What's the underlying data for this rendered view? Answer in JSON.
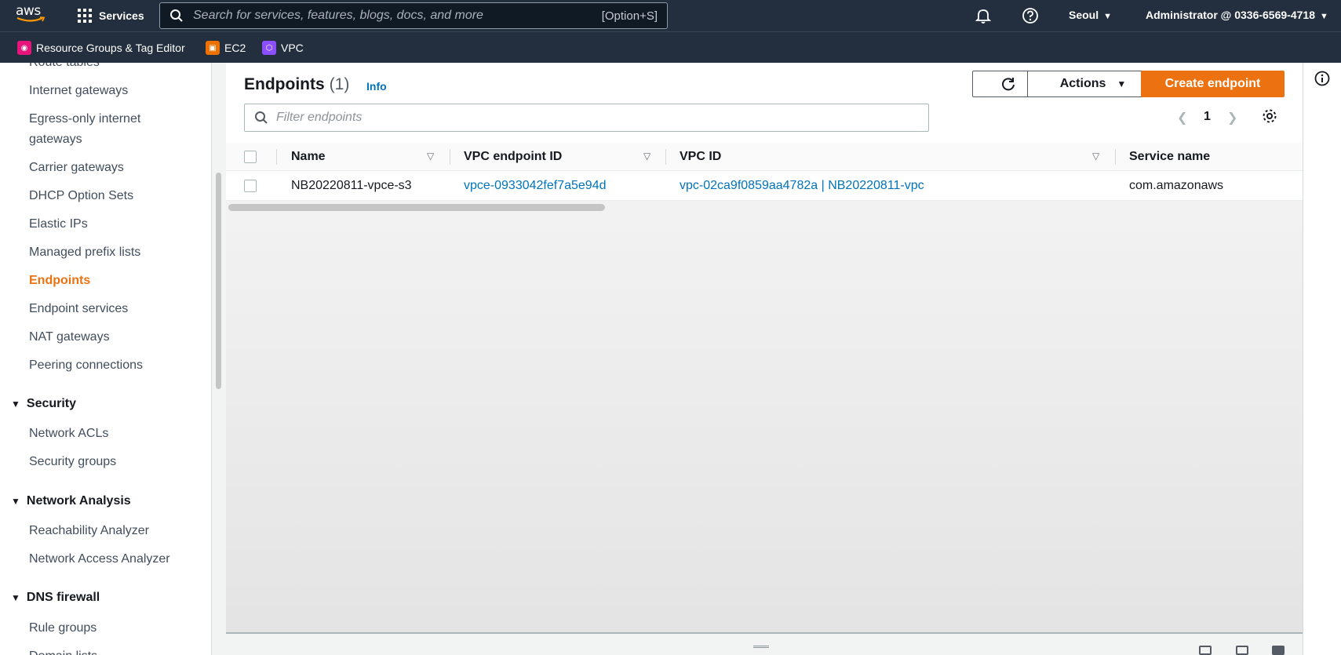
{
  "topnav": {
    "logo_text": "aws",
    "services_label": "Services",
    "search_placeholder": "Search for services, features, blogs, docs, and more",
    "search_shortcut": "[Option+S]",
    "region": "Seoul",
    "account": "Administrator @ 0336-6569-4718"
  },
  "favorites": [
    {
      "label": "Resource Groups & Tag Editor",
      "icon": "resource-groups-icon",
      "color": "#e7157b"
    },
    {
      "label": "EC2",
      "icon": "ec2-icon",
      "color": "#ed7100"
    },
    {
      "label": "VPC",
      "icon": "vpc-icon",
      "color": "#8c4fff"
    }
  ],
  "sidebar": {
    "items": [
      {
        "label": "Route tables"
      },
      {
        "label": "Internet gateways"
      },
      {
        "label": "Egress-only internet gateways"
      },
      {
        "label": "Carrier gateways"
      },
      {
        "label": "DHCP Option Sets"
      },
      {
        "label": "Elastic IPs"
      },
      {
        "label": "Managed prefix lists"
      },
      {
        "label": "Endpoints",
        "active": true
      },
      {
        "label": "Endpoint services"
      },
      {
        "label": "NAT gateways"
      },
      {
        "label": "Peering connections"
      }
    ],
    "sections": [
      {
        "title": "Security",
        "items": [
          "Network ACLs",
          "Security groups"
        ]
      },
      {
        "title": "Network Analysis",
        "items": [
          "Reachability Analyzer",
          "Network Access Analyzer"
        ]
      },
      {
        "title": "DNS firewall",
        "items": [
          "Rule groups",
          "Domain lists"
        ]
      }
    ]
  },
  "main": {
    "title": "Endpoints",
    "count": "(1)",
    "info": "Info",
    "actions_label": "Actions",
    "create_label": "Create endpoint",
    "filter_placeholder": "Filter endpoints",
    "page": "1",
    "columns": [
      "Name",
      "VPC endpoint ID",
      "VPC ID",
      "Service name"
    ],
    "rows": [
      {
        "name": "NB20220811-vpce-s3",
        "endpoint_id": "vpce-0933042fef7a5e94d",
        "vpc_id": "vpc-02ca9f0859aa4782a | NB20220811-vpc",
        "service_name": "com.amazonaws"
      }
    ]
  },
  "colors": {
    "nav_bg": "#232f3e",
    "accent_orange": "#ec7211",
    "link_blue": "#0073bb"
  }
}
